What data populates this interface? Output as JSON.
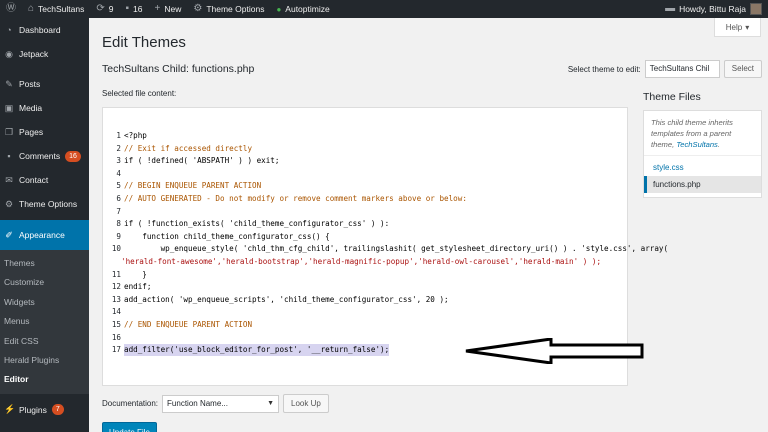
{
  "adminbar": {
    "site_name": "TechSultans",
    "updates_count": "9",
    "comments_count": "16",
    "new_label": "New",
    "theme_options_label": "Theme Options",
    "autoptimize_label": "Autoptimize",
    "howdy_label": "Howdy, Bittu Raja"
  },
  "sidebar": {
    "items": [
      {
        "label": "Dashboard",
        "icon": "dashboard-icon"
      },
      {
        "label": "Jetpack",
        "icon": "jetpack-icon"
      },
      {
        "label": "Posts",
        "icon": "pin-icon"
      },
      {
        "label": "Media",
        "icon": "media-icon"
      },
      {
        "label": "Pages",
        "icon": "pages-icon"
      },
      {
        "label": "Comments",
        "icon": "comment-icon",
        "badge": "16"
      },
      {
        "label": "Contact",
        "icon": "mail-icon"
      },
      {
        "label": "Theme Options",
        "icon": "gear-icon"
      },
      {
        "label": "Appearance",
        "icon": "brush-icon"
      },
      {
        "label": "Plugins",
        "icon": "plug-icon",
        "badge": "7"
      }
    ],
    "submenu": [
      "Themes",
      "Customize",
      "Widgets",
      "Menus",
      "Edit CSS",
      "Herald Plugins",
      "Editor"
    ]
  },
  "help_label": "Help",
  "page_title": "Edit Themes",
  "file_title": "TechSultans Child: functions.php",
  "select_theme": {
    "label": "Select theme to edit:",
    "value": "TechSultans Chil",
    "button": "Select"
  },
  "selected_file_label": "Selected file content:",
  "code_lines": [
    {
      "n": "1",
      "text": "<?php",
      "cls": "c-plain"
    },
    {
      "n": "2",
      "text": "// Exit if accessed directly",
      "cls": "c-comment"
    },
    {
      "n": "3",
      "text": "if ( !defined( 'ABSPATH' ) ) exit;",
      "cls": "c-plain"
    },
    {
      "n": "4",
      "text": "",
      "cls": "c-plain"
    },
    {
      "n": "5",
      "text": "// BEGIN ENQUEUE PARENT ACTION",
      "cls": "c-comment"
    },
    {
      "n": "6",
      "text": "// AUTO GENERATED - Do not modify or remove comment markers above or below:",
      "cls": "c-comment"
    },
    {
      "n": "7",
      "text": "",
      "cls": "c-plain"
    },
    {
      "n": "8",
      "text": "if ( !function_exists( 'child_theme_configurator_css' ) ):",
      "cls": "c-plain"
    },
    {
      "n": "9",
      "text": "    function child_theme_configurator_css() {",
      "cls": "c-plain"
    },
    {
      "n": "10",
      "text": "        wp_enqueue_style( 'chld_thm_cfg_child', trailingslashit( get_stylesheet_directory_uri() ) . 'style.css', array(",
      "cls": "c-plain"
    },
    {
      "n": "",
      "text": "'herald-font-awesome','herald-bootstrap','herald-magnific-popup','herald-owl-carousel','herald-main' ) );",
      "cls": "c-str"
    },
    {
      "n": "11",
      "text": "    }",
      "cls": "c-plain"
    },
    {
      "n": "12",
      "text": "endif;",
      "cls": "c-plain"
    },
    {
      "n": "13",
      "text": "add_action( 'wp_enqueue_scripts', 'child_theme_configurator_css', 20 );",
      "cls": "c-plain"
    },
    {
      "n": "14",
      "text": "",
      "cls": "c-plain"
    },
    {
      "n": "15",
      "text": "// END ENQUEUE PARENT ACTION",
      "cls": "c-comment"
    },
    {
      "n": "16",
      "text": "",
      "cls": "c-plain"
    },
    {
      "n": "17",
      "text": "add_filter('use_block_editor_for_post', '__return_false');",
      "cls": "c-plain",
      "highlight": true
    }
  ],
  "theme_files": {
    "title": "Theme Files",
    "note_prefix": "This child theme inherits templates from a parent theme,",
    "note_link": "TechSultans",
    "note_suffix": ".",
    "files": [
      "style.css",
      "functions.php"
    ],
    "current": "functions.php"
  },
  "documentation": {
    "label": "Documentation:",
    "placeholder": "Function Name...",
    "button": "Look Up"
  },
  "update_button": "Update File",
  "colors": {
    "admin_dark": "#23282d",
    "accent_blue": "#0073aa",
    "button_blue": "#0085ba",
    "badge_orange": "#d54e21"
  }
}
